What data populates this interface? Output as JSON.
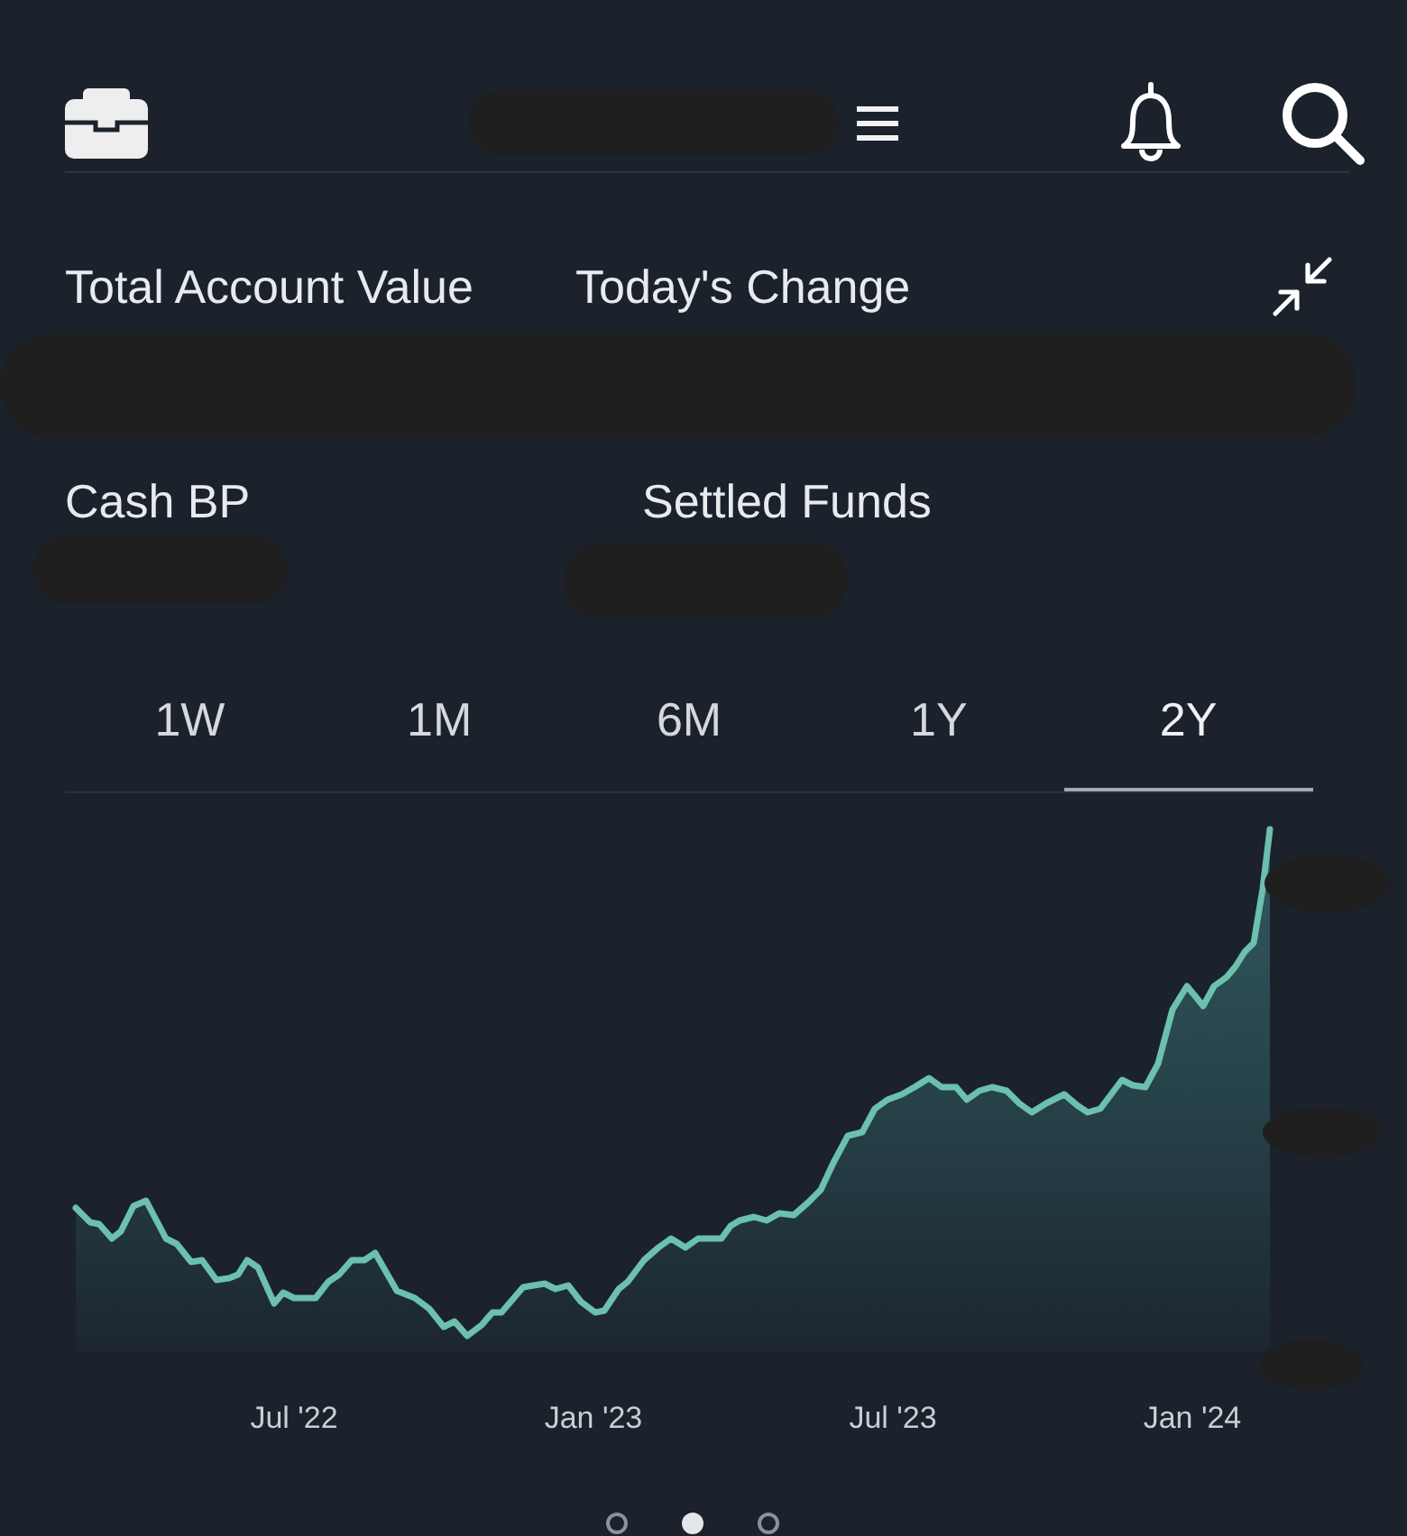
{
  "summary_rows": [
    {
      "labels": [
        "Total Account Value",
        "Today's Change"
      ]
    },
    {
      "labels": [
        "Cash BP",
        "Settled Funds"
      ]
    }
  ],
  "range_tabs": [
    {
      "label": "1W",
      "selected": false
    },
    {
      "label": "1M",
      "selected": false
    },
    {
      "label": "6M",
      "selected": false
    },
    {
      "label": "1Y",
      "selected": false
    },
    {
      "label": "2Y",
      "selected": true
    }
  ],
  "chart": {
    "x_labels": [
      "Jul '22",
      "Jan '23",
      "Jul '23",
      "Jan '24"
    ]
  },
  "page_dots": [
    {
      "selected": false
    },
    {
      "selected": true
    },
    {
      "selected": false
    }
  ]
}
